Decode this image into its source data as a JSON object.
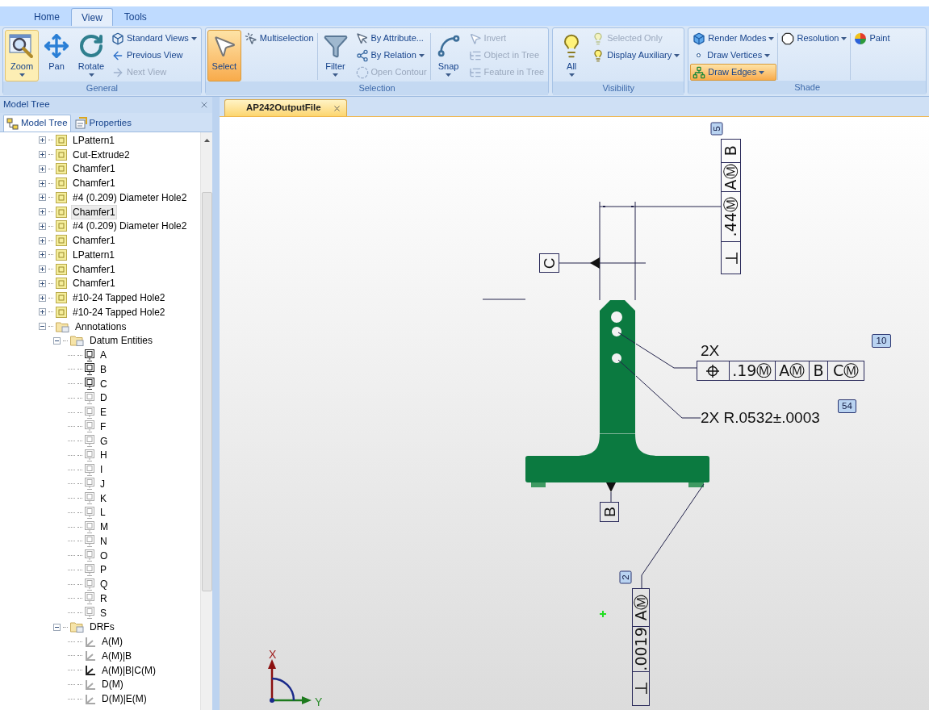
{
  "ribbon": {
    "tabs": [
      {
        "label": "Home",
        "selected": false
      },
      {
        "label": "View",
        "selected": true
      },
      {
        "label": "Tools",
        "selected": false
      }
    ],
    "groups": [
      {
        "title": "General",
        "columns": [
          {
            "kind": "large",
            "label": "Zoom",
            "dropdown": true,
            "pressed": true,
            "disabled": false
          },
          {
            "kind": "large",
            "label": "Pan",
            "dropdown": false,
            "pressed": false,
            "disabled": false
          },
          {
            "kind": "large",
            "label": "Rotate",
            "dropdown": true,
            "pressed": false,
            "disabled": false
          },
          {
            "kind": "stack",
            "items": [
              {
                "label": "Standard Views",
                "dropdown": true,
                "pressed": false,
                "disabled": false
              },
              {
                "label": "Previous View",
                "dropdown": false,
                "pressed": false,
                "disabled": false
              },
              {
                "label": "Next View",
                "dropdown": false,
                "pressed": false,
                "disabled": true
              }
            ]
          }
        ]
      },
      {
        "title": "Selection",
        "columns": [
          {
            "kind": "large",
            "label": "Select",
            "dropdown": false,
            "pressed": true,
            "disabled": false
          },
          {
            "kind": "stack",
            "items": [
              {
                "label": "Multiselection",
                "dropdown": false,
                "pressed": false,
                "disabled": false
              }
            ]
          },
          {
            "kind": "large",
            "label": "Filter",
            "dropdown": true,
            "pressed": false,
            "disabled": false
          },
          {
            "kind": "stack",
            "items": [
              {
                "label": "By Attribute...",
                "dropdown": false,
                "pressed": false,
                "disabled": false
              },
              {
                "label": "By Relation",
                "dropdown": true,
                "pressed": false,
                "disabled": false
              },
              {
                "label": "Open Contour",
                "dropdown": false,
                "pressed": false,
                "disabled": true
              }
            ]
          },
          {
            "kind": "large",
            "label": "Snap",
            "dropdown": true,
            "pressed": false,
            "disabled": false
          },
          {
            "kind": "stack",
            "items": [
              {
                "label": "Invert",
                "dropdown": false,
                "pressed": false,
                "disabled": true
              },
              {
                "label": "Object in Tree",
                "dropdown": false,
                "pressed": false,
                "disabled": true
              },
              {
                "label": "Feature in Tree",
                "dropdown": false,
                "pressed": false,
                "disabled": true
              }
            ]
          }
        ]
      },
      {
        "title": "Visibility",
        "columns": [
          {
            "kind": "large",
            "label": "All",
            "dropdown": true,
            "pressed": false,
            "disabled": false
          },
          {
            "kind": "stack",
            "items": [
              {
                "label": "Selected Only",
                "dropdown": false,
                "pressed": false,
                "disabled": true
              },
              {
                "label": "Display Auxiliary",
                "dropdown": true,
                "pressed": false,
                "disabled": false
              }
            ]
          }
        ]
      },
      {
        "title": "Shade",
        "columns": [
          {
            "kind": "stack",
            "items": [
              {
                "label": "Render Modes",
                "dropdown": true,
                "pressed": false,
                "disabled": false
              },
              {
                "label": "Draw Vertices",
                "dropdown": true,
                "pressed": false,
                "disabled": false
              },
              {
                "label": "Draw Edges",
                "dropdown": true,
                "pressed": true,
                "disabled": false
              }
            ]
          },
          {
            "kind": "stack",
            "items": [
              {
                "label": "Resolution",
                "dropdown": true,
                "pressed": false,
                "disabled": false
              }
            ]
          },
          {
            "kind": "stack",
            "items": [
              {
                "label": "Paint",
                "dropdown": false,
                "pressed": false,
                "disabled": false
              }
            ]
          }
        ]
      }
    ]
  },
  "model_tree": {
    "title": "Model Tree",
    "tabs": [
      {
        "label": "Model Tree",
        "selected": true
      },
      {
        "label": "Properties",
        "selected": false
      }
    ],
    "items": [
      {
        "label": "LPattern1",
        "kind": "feature",
        "expanded": false,
        "selected": false
      },
      {
        "label": "Cut-Extrude2",
        "kind": "feature",
        "expanded": false,
        "selected": false
      },
      {
        "label": "Chamfer1",
        "kind": "feature",
        "expanded": false,
        "selected": false
      },
      {
        "label": "Chamfer1",
        "kind": "feature",
        "expanded": false,
        "selected": false
      },
      {
        "label": "#4 (0.209) Diameter Hole2",
        "kind": "feature",
        "expanded": false,
        "selected": false
      },
      {
        "label": "Chamfer1",
        "kind": "feature",
        "expanded": false,
        "selected": true
      },
      {
        "label": "#4 (0.209) Diameter Hole2",
        "kind": "feature",
        "expanded": false,
        "selected": false
      },
      {
        "label": "Chamfer1",
        "kind": "feature",
        "expanded": false,
        "selected": false
      },
      {
        "label": "LPattern1",
        "kind": "feature",
        "expanded": false,
        "selected": false
      },
      {
        "label": "Chamfer1",
        "kind": "feature",
        "expanded": false,
        "selected": false
      },
      {
        "label": "Chamfer1",
        "kind": "feature",
        "expanded": false,
        "selected": false
      },
      {
        "label": "#10-24 Tapped Hole2",
        "kind": "feature",
        "expanded": false,
        "selected": false
      },
      {
        "label": "#10-24 Tapped Hole2",
        "kind": "feature",
        "expanded": false,
        "selected": false
      },
      {
        "label": "Annotations",
        "kind": "folder",
        "expanded": true,
        "selected": false,
        "children": [
          {
            "label": "Datum Entities",
            "kind": "folder",
            "expanded": true,
            "selected": false,
            "children": [
              {
                "label": "A",
                "kind": "datum",
                "visible": true,
                "selected": false
              },
              {
                "label": "B",
                "kind": "datum",
                "visible": true,
                "selected": false
              },
              {
                "label": "C",
                "kind": "datum",
                "visible": true,
                "selected": false
              },
              {
                "label": "D",
                "kind": "datum",
                "visible": false,
                "selected": false
              },
              {
                "label": "E",
                "kind": "datum",
                "visible": false,
                "selected": false
              },
              {
                "label": "F",
                "kind": "datum",
                "visible": false,
                "selected": false
              },
              {
                "label": "G",
                "kind": "datum",
                "visible": false,
                "selected": false
              },
              {
                "label": "H",
                "kind": "datum",
                "visible": false,
                "selected": false
              },
              {
                "label": "I",
                "kind": "datum",
                "visible": false,
                "selected": false
              },
              {
                "label": "J",
                "kind": "datum",
                "visible": false,
                "selected": false
              },
              {
                "label": "K",
                "kind": "datum",
                "visible": false,
                "selected": false
              },
              {
                "label": "L",
                "kind": "datum",
                "visible": false,
                "selected": false
              },
              {
                "label": "M",
                "kind": "datum",
                "visible": false,
                "selected": false
              },
              {
                "label": "N",
                "kind": "datum",
                "visible": false,
                "selected": false
              },
              {
                "label": "O",
                "kind": "datum",
                "visible": false,
                "selected": false
              },
              {
                "label": "P",
                "kind": "datum",
                "visible": false,
                "selected": false
              },
              {
                "label": "Q",
                "kind": "datum",
                "visible": false,
                "selected": false
              },
              {
                "label": "R",
                "kind": "datum",
                "visible": false,
                "selected": false
              },
              {
                "label": "S",
                "kind": "datum",
                "visible": false,
                "selected": false
              }
            ]
          },
          {
            "label": "DRFs",
            "kind": "folder",
            "expanded": true,
            "selected": false,
            "children": [
              {
                "label": "A(M)",
                "kind": "drf",
                "visible": false,
                "selected": false
              },
              {
                "label": "A(M)|B",
                "kind": "drf",
                "visible": false,
                "selected": false
              },
              {
                "label": "A(M)|B|C(M)",
                "kind": "drf",
                "visible": true,
                "selected": false
              },
              {
                "label": "D(M)",
                "kind": "drf",
                "visible": false,
                "selected": false
              },
              {
                "label": "D(M)|E(M)",
                "kind": "drf",
                "visible": false,
                "selected": false
              }
            ]
          }
        ]
      }
    ]
  },
  "document_tabs": [
    {
      "label": "AP242OutputFile",
      "selected": true
    }
  ],
  "viewport": {
    "annotations": [
      {
        "kind": "datum",
        "label": "C"
      },
      {
        "kind": "datum",
        "label": "B"
      },
      {
        "kind": "perpendicularity",
        "flag": "5",
        "cells": [
          ".44Ⓜ",
          "AⓂ",
          "B"
        ]
      },
      {
        "kind": "position",
        "flag": "10",
        "prefix": "2X",
        "cells": [
          ".19Ⓜ",
          "AⓂ",
          "B",
          "CⓂ"
        ]
      },
      {
        "kind": "dimension",
        "text": "2X R.0532±.0003",
        "flag": "54"
      },
      {
        "kind": "perpendicularity",
        "flag": "2",
        "cells": [
          ".0019",
          "AⓂ"
        ]
      }
    ],
    "triad": {
      "x_label": "X",
      "y_label": "Y"
    }
  }
}
